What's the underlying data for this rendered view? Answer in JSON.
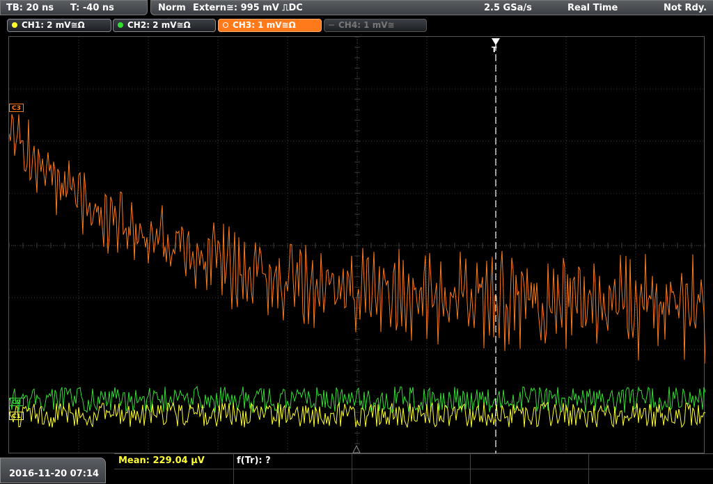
{
  "header": {
    "timebase": "TB: 20 ns",
    "trigger_time": "T: -40 ns",
    "mode": "Norm",
    "trigger_source": "Extern≅: 995 mV ⎍DC",
    "sample_rate": "2.5 GSa/s",
    "acq_mode": "Real Time",
    "status": "Not Rdy."
  },
  "channels": [
    {
      "label": "CH1: 2 mV≅Ω",
      "color": "#ffff33",
      "state": "on"
    },
    {
      "label": "CH2: 2 mV≅Ω",
      "color": "#33dd33",
      "state": "on"
    },
    {
      "label": "CH3: 1 mV≅Ω",
      "color": "#ff7a1a",
      "state": "active"
    },
    {
      "label": "CH4: 1 mV≅",
      "color": "#666666",
      "state": "off"
    }
  ],
  "markers": {
    "ch3": "C3",
    "ch2": "C2",
    "ch1": "C1",
    "trigger": "T"
  },
  "footer": {
    "datetime": "2016-11-20 07:14",
    "meas1": "Mean: 229.04 µV",
    "meas2": "f(Tr): ?"
  },
  "colors": {
    "ch1": "#ffff33",
    "ch2": "#33dd33",
    "ch3": "#ff7a1a",
    "grid": "#3a3a3a"
  }
}
